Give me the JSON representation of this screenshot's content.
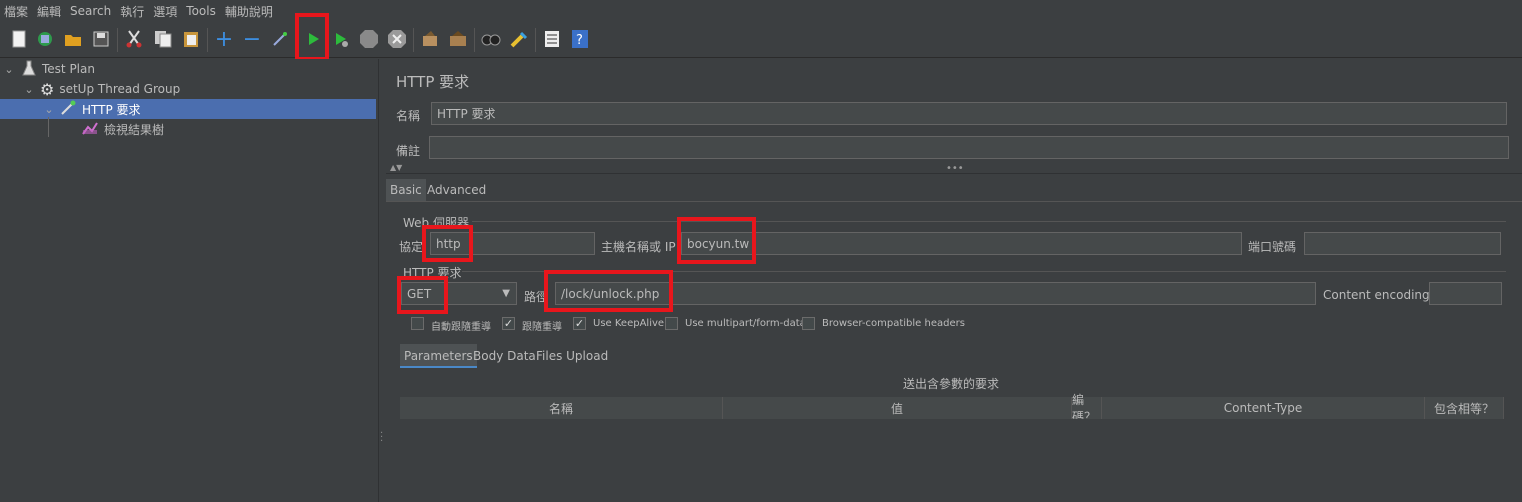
{
  "menu": [
    "檔案",
    "編輯",
    "Search",
    "執行",
    "選項",
    "Tools",
    "輔助說明"
  ],
  "toolbar_icons": [
    "new-icon",
    "templates-icon",
    "open-icon",
    "save-icon",
    "cut-icon",
    "copy-icon",
    "paste-icon",
    "expand-icon",
    "collapse-icon",
    "toggle-icon",
    "start-icon",
    "start-no-pause-icon",
    "stop-icon",
    "shutdown-icon",
    "clear-icon",
    "clear-all-icon",
    "search-icon",
    "reset-search-icon",
    "function-helper-icon",
    "help-icon"
  ],
  "tree": {
    "items": [
      {
        "label": "Test Plan"
      },
      {
        "label": "setUp Thread Group"
      },
      {
        "label": "HTTP 要求"
      },
      {
        "label": "檢視結果樹"
      }
    ]
  },
  "panel": {
    "title": "HTTP 要求",
    "name_label": "名稱",
    "name_value": "HTTP 要求",
    "comment_label": "備註",
    "comment_value": "",
    "tabs": [
      "Basic",
      "Advanced"
    ],
    "web_server_legend": "Web 伺服器",
    "protocol_label": "協定",
    "protocol_value": "http",
    "host_label": "主機名稱或 IP",
    "host_value": "bocyun.tw",
    "port_label": "端口號碼",
    "port_value": "",
    "http_request_legend": "HTTP 要求",
    "method_value": "GET",
    "path_label": "路徑",
    "path_value": "/lock/unlock.php",
    "encoding_label": "Content encoding:",
    "encoding_value": "",
    "checkboxes": [
      {
        "label": "自動跟隨重導",
        "checked": false
      },
      {
        "label": "跟隨重導",
        "checked": true
      },
      {
        "label": "Use KeepAlive",
        "checked": true
      },
      {
        "label": "Use multipart/form-data",
        "checked": false
      },
      {
        "label": "Browser-compatible headers",
        "checked": false
      }
    ],
    "sub_tabs": [
      "Parameters",
      "Body Data",
      "Files Upload"
    ],
    "params_caption": "送出含參數的要求",
    "columns": [
      "名稱",
      "值",
      "編碼？",
      "Content-Type",
      "包含相等？"
    ]
  },
  "colors": {
    "highlight": "#e8161c",
    "selection": "#4b6eaf",
    "background": "#3c3f41"
  }
}
